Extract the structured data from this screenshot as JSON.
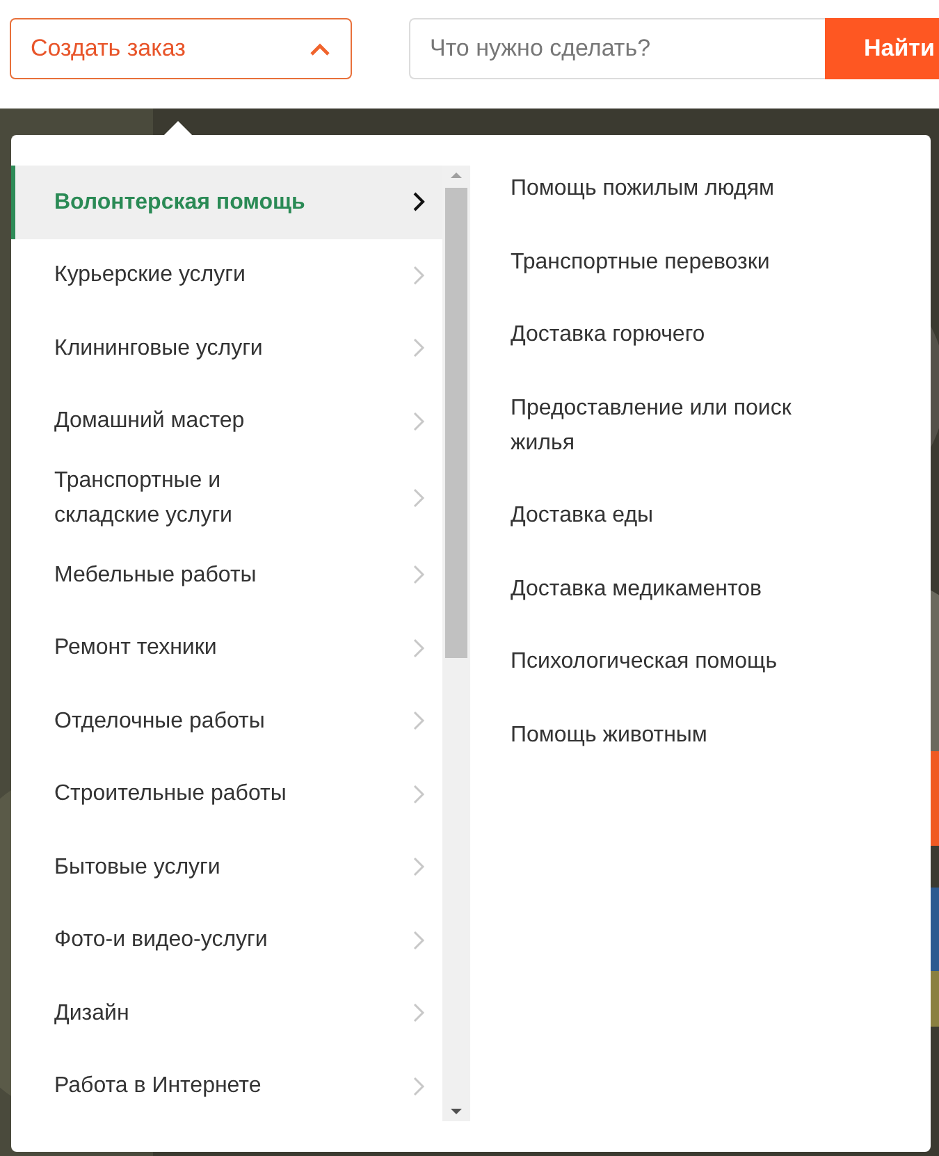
{
  "order_dropdown": {
    "label": "Создать заказ",
    "expanded": true
  },
  "search": {
    "placeholder": "Что нужно сделать?",
    "button": "Найти"
  },
  "categories": [
    {
      "label": "Волонтерская помощь",
      "selected": true
    },
    {
      "label": "Курьерские услуги",
      "selected": false
    },
    {
      "label": "Клининговые услуги",
      "selected": false
    },
    {
      "label": "Домашний мастер",
      "selected": false
    },
    {
      "label": "Транспортные и складские услуги",
      "selected": false
    },
    {
      "label": "Мебельные работы",
      "selected": false
    },
    {
      "label": "Ремонт техники",
      "selected": false
    },
    {
      "label": "Отделочные работы",
      "selected": false
    },
    {
      "label": "Строительные работы",
      "selected": false
    },
    {
      "label": "Бытовые услуги",
      "selected": false
    },
    {
      "label": "Фото-и видео-услуги",
      "selected": false
    },
    {
      "label": "Дизайн",
      "selected": false
    },
    {
      "label": "Работа в Интернете",
      "selected": false
    }
  ],
  "subcategories": [
    "Помощь пожилым людям",
    "Транспортные перевозки",
    "Доставка горючего",
    "Предоставление или поиск жилья",
    "Доставка еды",
    "Доставка медикаментов",
    "Психологическая помощь",
    "Помощь животным"
  ]
}
